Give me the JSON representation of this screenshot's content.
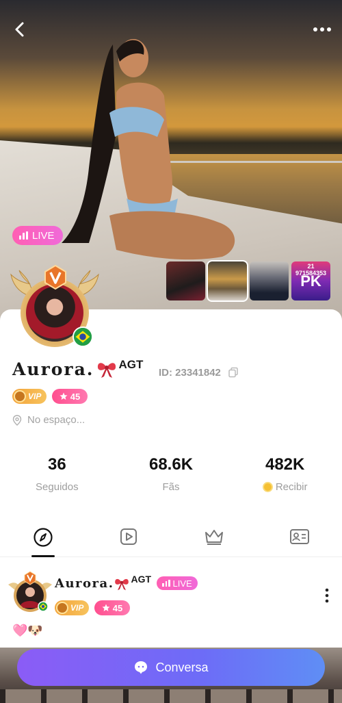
{
  "header": {
    "live_label": "LIVE",
    "back_icon": "chevron-left-icon",
    "more_icon": "more-horizontal-icon"
  },
  "thumbnails": [
    {
      "name": "photo-1"
    },
    {
      "name": "photo-2",
      "selected": true
    },
    {
      "name": "photo-3"
    },
    {
      "name": "pk-event",
      "top_text": "21 971584353",
      "label": "PK"
    }
  ],
  "profile": {
    "name": "Aurora.",
    "agt": "AGT",
    "id_label": "ID: 23341842",
    "vip_label": "VIP",
    "level": "45",
    "location": "No espaço...",
    "country_flag": "brazil-flag"
  },
  "stats": [
    {
      "value": "36",
      "label": "Seguidos"
    },
    {
      "value": "68.6K",
      "label": "Fãs"
    },
    {
      "value": "482K",
      "label": "Recibir"
    }
  ],
  "tabs": [
    {
      "icon": "compass-icon",
      "active": true
    },
    {
      "icon": "play-video-icon",
      "active": false
    },
    {
      "icon": "crown-icon",
      "active": false
    },
    {
      "icon": "profile-card-icon",
      "active": false
    }
  ],
  "post": {
    "name": "Aurora.",
    "agt": "AGT",
    "live_label": "LIVE",
    "vip_label": "VIP",
    "level": "45",
    "text": "🩷🐶"
  },
  "chat_button": {
    "label": "Conversa"
  },
  "colors": {
    "live_pink": "#f06ad9",
    "vip_gold": "#f3a43b",
    "level_pink": "#ff4f8f",
    "chat_purple": "#8b5cf6",
    "chat_blue": "#5f8ef5"
  }
}
